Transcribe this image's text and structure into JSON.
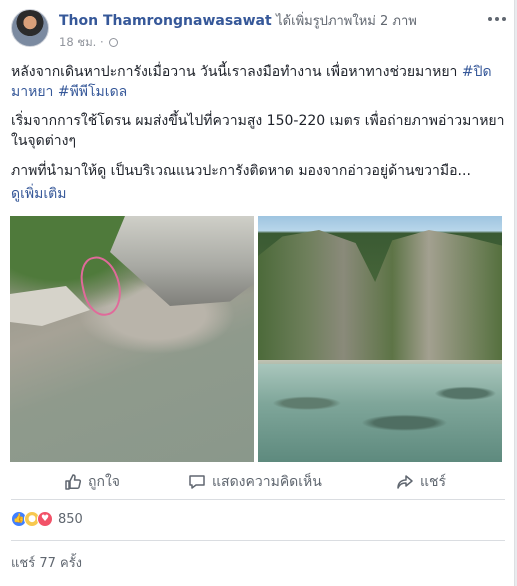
{
  "post": {
    "author": "Thon Thamrongnawasawat",
    "action": "ได้เพิ่มรูปภาพใหม่ 2 ภาพ",
    "time": "18 ชม.",
    "dot": "·",
    "paragraphs": {
      "p1_text": "หลังจากเดินหาปะการังเมื่อวาน วันนี้เราลงมือทำงาน เพื่อหาทางช่วยมาหยา ",
      "p1_tag1": "#ปิดมาหยา",
      "p1_tag2": "#พีพีโมเดล",
      "p2": "เริ่มจากการใช้โดรน ผมส่งขึ้นไปที่ความสูง 150-220 เมตร เพื่อถ่ายภาพอ่าวมาหยาในจุดต่างๆ",
      "p3": "ภาพที่นำมาให้ดู เป็นบริเวณแนวปะการังติดหาด มองจากอ่าวอยู่ด้านขวามือ...",
      "see_more": "ดูเพิ่มเติม"
    }
  },
  "actions": {
    "like": "ถูกใจ",
    "comment": "แสดงความคิดเห็น",
    "share": "แชร์"
  },
  "reactions": {
    "count": "850",
    "types": [
      "like",
      "sad",
      "love"
    ]
  },
  "shares_text": "แชร์ 77 ครั้ง",
  "icons": {
    "more": "more-horizontal-icon",
    "globe": "globe-icon",
    "like": "thumbs-up-icon",
    "comment": "speech-bubble-icon",
    "share": "share-arrow-icon"
  },
  "colors": {
    "link": "#365899",
    "text": "#1d2129",
    "muted": "#606770",
    "like_blue": "#4080ff",
    "love_red": "#f25268",
    "sad_yellow": "#f7c84e"
  }
}
